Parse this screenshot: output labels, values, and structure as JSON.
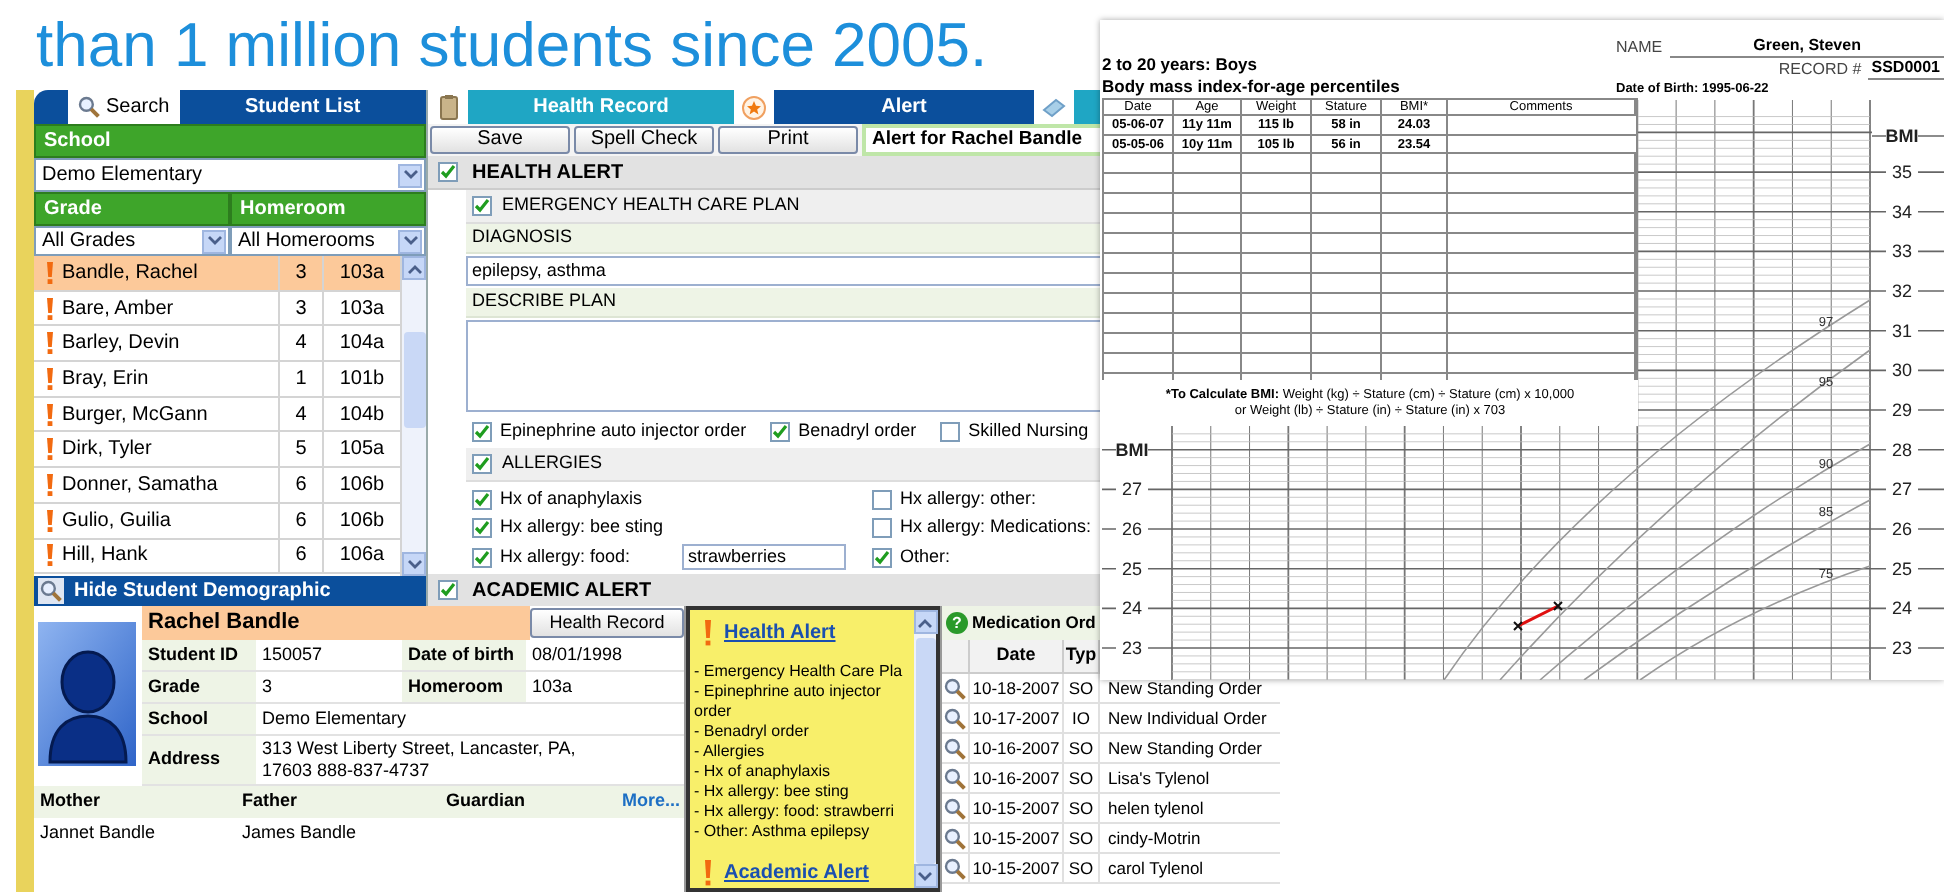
{
  "headline": "than 1 million students since 2005.",
  "student_list": {
    "tabs": [
      {
        "label": "Search",
        "selected": false
      },
      {
        "label": "Student List",
        "selected": true
      }
    ],
    "school_label": "School",
    "school_select": "Demo Elementary",
    "grade_label": "Grade",
    "homeroom_label": "Homeroom",
    "grade_select": "All Grades",
    "homeroom_select": "All Homerooms",
    "rows": [
      {
        "name": "Bandle, Rachel",
        "grade": "3",
        "room": "103a",
        "alert": true,
        "selected": true
      },
      {
        "name": "Bare, Amber",
        "grade": "3",
        "room": "103a",
        "alert": true,
        "selected": false
      },
      {
        "name": "Barley, Devin",
        "grade": "4",
        "room": "104a",
        "alert": true,
        "selected": false
      },
      {
        "name": "Bray, Erin",
        "grade": "1",
        "room": "101b",
        "alert": true,
        "selected": false
      },
      {
        "name": "Burger, McGann",
        "grade": "4",
        "room": "104b",
        "alert": true,
        "selected": false
      },
      {
        "name": "Dirk, Tyler",
        "grade": "5",
        "room": "105a",
        "alert": true,
        "selected": false
      },
      {
        "name": "Donner, Samatha",
        "grade": "6",
        "room": "106b",
        "alert": true,
        "selected": false
      },
      {
        "name": "Gulio, Guilia",
        "grade": "6",
        "room": "106b",
        "alert": true,
        "selected": false
      },
      {
        "name": "Hill, Hank",
        "grade": "6",
        "room": "106a",
        "alert": true,
        "selected": false
      }
    ],
    "toggle": "Hide Student Demographic"
  },
  "health_record": {
    "tabs": [
      {
        "label": "Health Record",
        "selected": false
      },
      {
        "label": "Alert",
        "selected": true
      }
    ],
    "buttons": [
      "Save",
      "Spell Check",
      "Print"
    ],
    "heading": "Alert for Rachel Bandle",
    "form": [
      {
        "kind": "section",
        "label": "HEALTH ALERT",
        "checked": true
      },
      {
        "kind": "subsection",
        "label": "EMERGENCY HEALTH CARE PLAN",
        "checked": true
      },
      {
        "kind": "label",
        "label": "DIAGNOSIS"
      },
      {
        "kind": "input",
        "value": "epilepsy, asthma"
      },
      {
        "kind": "label",
        "label": "DESCRIBE PLAN"
      },
      {
        "kind": "textarea"
      },
      {
        "kind": "options",
        "items": [
          {
            "label": "Epinephrine auto injector order",
            "checked": true
          },
          {
            "label": "Benadryl order",
            "checked": true
          },
          {
            "label": "Skilled Nursing",
            "checked": false
          }
        ]
      },
      {
        "kind": "subsection",
        "label": "ALLERGIES",
        "checked": true
      },
      {
        "kind": "grid",
        "columns": [
          [
            {
              "label": "Hx of anaphylaxis",
              "checked": true
            },
            {
              "label": "Hx allergy: bee sting",
              "checked": true
            },
            {
              "label": "Hx allergy: food:",
              "checked": true,
              "value": "strawberries"
            }
          ],
          [
            {
              "label": "Hx allergy: other:",
              "checked": false
            },
            {
              "label": "Hx allergy: Medications:",
              "checked": false
            },
            {
              "label": "Other:",
              "checked": true
            }
          ]
        ]
      },
      {
        "kind": "section",
        "label": "ACADEMIC ALERT",
        "checked": true
      }
    ]
  },
  "demographics": {
    "name": "Rachel Bandle",
    "button": "Health Record",
    "rows": [
      {
        "label": "Student ID",
        "value": "150057",
        "label_2": "Date of birth",
        "value_2": "08/01/1998"
      },
      {
        "label": "Grade",
        "value": "3",
        "label_2": "Homeroom",
        "value_2": "103a"
      },
      {
        "label": "School",
        "value": "Demo Elementary"
      },
      {
        "label": "Address",
        "value": "313 West Liberty Street, Lancaster, PA,\n17603  888-837-4737"
      }
    ],
    "guardian_columns": [
      "Mother",
      "Father",
      "Guardian"
    ],
    "more": "More...",
    "guardians": [
      "Jannet Bandle",
      "James Bandle"
    ]
  },
  "alert_popup": {
    "sections": [
      {
        "title": "Health Alert",
        "lines": [
          "- Emergency Health Care Pla",
          "- Epinephrine auto injector order",
          "- Benadryl order",
          "- Allergies",
          "- Hx of anaphylaxis",
          "- Hx allergy: bee sting",
          "- Hx allergy: food: strawberri",
          "- Other: Asthma epilepsy"
        ]
      },
      {
        "title": "Academic Alert"
      }
    ]
  },
  "medication": {
    "help_icon": "?",
    "title": "Medication Ord",
    "columns": [
      "Date",
      "Typ"
    ],
    "rows": [
      {
        "date": "10-18-2007",
        "type": "SO",
        "description": "New Standing Order"
      },
      {
        "date": "10-17-2007",
        "type": "IO",
        "description": "New Individual Order"
      },
      {
        "date": "10-16-2007",
        "type": "SO",
        "description": "New Standing Order"
      },
      {
        "date": "10-16-2007",
        "type": "SO",
        "description": "Lisa's Tylenol"
      },
      {
        "date": "10-15-2007",
        "type": "SO",
        "description": "helen tylenol"
      },
      {
        "date": "10-15-2007",
        "type": "SO",
        "description": "cindy-Motrin"
      },
      {
        "date": "10-15-2007",
        "type": "SO",
        "description": "carol Tylenol"
      }
    ]
  },
  "bmi_chart": {
    "title": "2 to 20 years: Boys",
    "subtitle": "Body mass index-for-age percentiles",
    "name_label": "NAME",
    "name": "Green, Steven",
    "record_label": "RECORD #",
    "record": "SSD0001",
    "dob": "Date of Birth: 1995-06-22",
    "columns": [
      "Date",
      "Age",
      "Weight",
      "Stature",
      "BMI*",
      "Comments"
    ],
    "rows": [
      [
        "05-06-07",
        "11y 11m",
        "115 lb",
        "58 in",
        "24.03"
      ],
      [
        "05-05-06",
        "10y 11m",
        "105 lb",
        "56 in",
        "23.54"
      ]
    ],
    "note": [
      {
        "bold": "*To Calculate BMI:",
        "text": "Weight (kg) ÷ Stature (cm) ÷ Stature (cm) x 10,000"
      },
      {
        "text": "or  Weight (lb) ÷ Stature (in) ÷ Stature (in) x 703"
      }
    ],
    "right_axis_label": "BMI",
    "right_ticks": [
      "35",
      "34",
      "33",
      "32",
      "31",
      "30",
      "29",
      "28",
      "27",
      "26",
      "25",
      "24",
      "23"
    ],
    "left_axis_label": "BMI",
    "left_ticks": [
      "27",
      "26",
      "25",
      "24",
      "23"
    ],
    "percentiles": [
      "97",
      "95",
      "90",
      "85",
      "75"
    ]
  }
}
